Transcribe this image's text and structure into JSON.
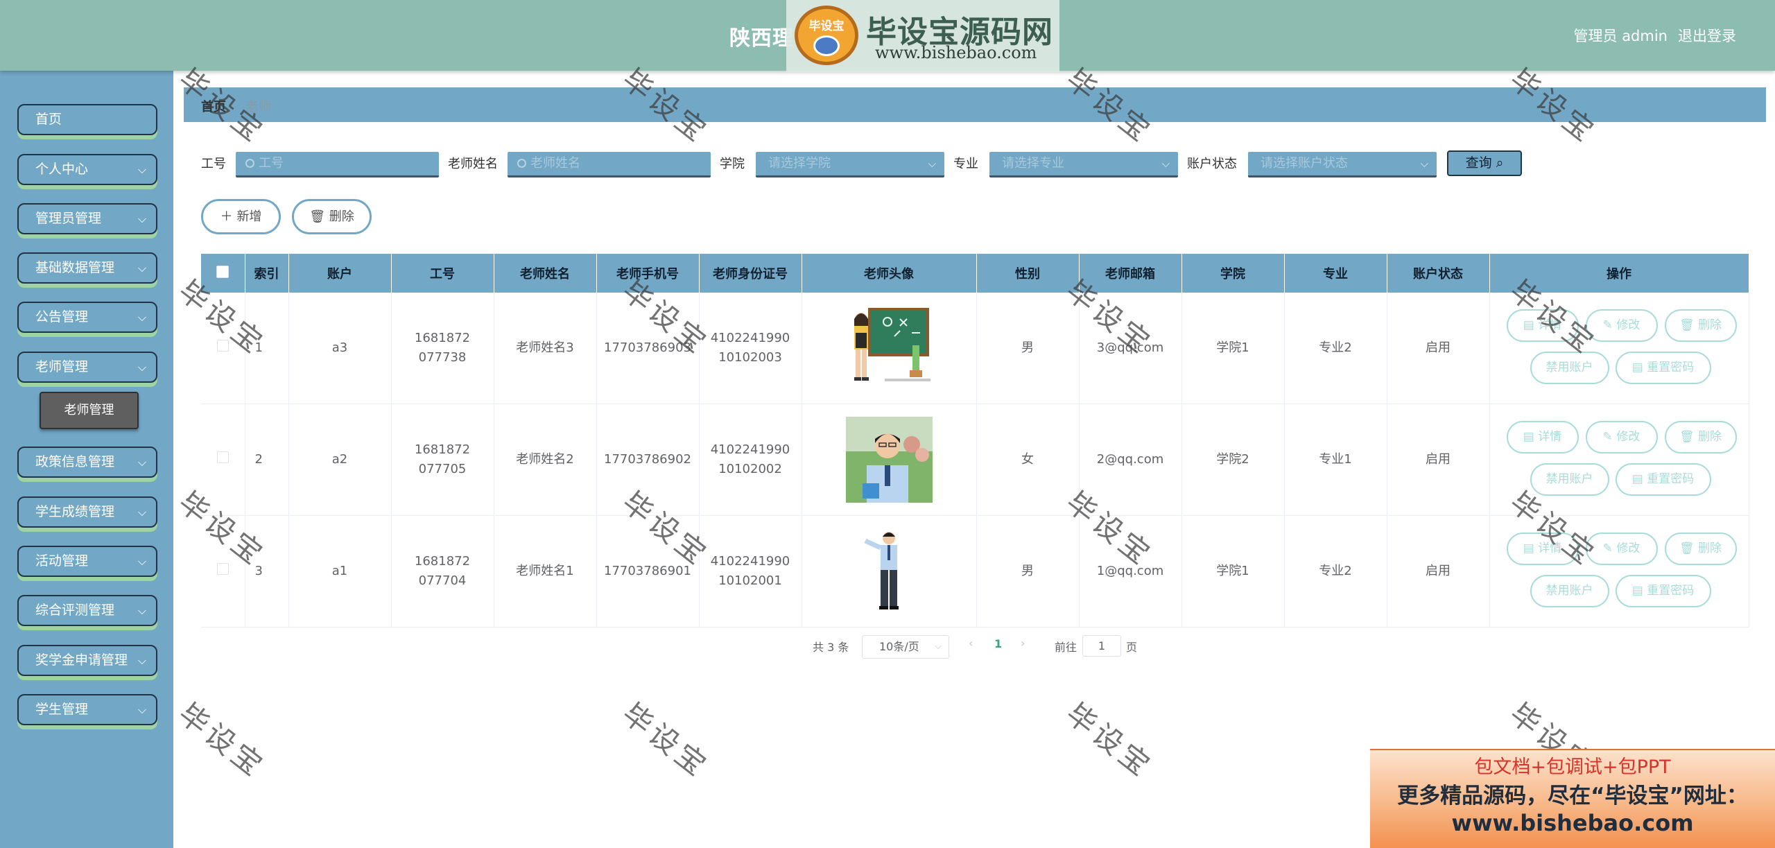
{
  "header": {
    "title": "陕西理",
    "user": "管理员 admin",
    "logout": "退出登录"
  },
  "logo": {
    "badge": "毕设宝",
    "main": "毕设宝源码网",
    "url": "www.bishebao.com"
  },
  "sidebar": {
    "items": [
      {
        "label": "首页"
      },
      {
        "label": "个人中心"
      },
      {
        "label": "管理员管理"
      },
      {
        "label": "基础数据管理"
      },
      {
        "label": "公告管理"
      },
      {
        "label": "老师管理"
      },
      {
        "label": "政策信息管理"
      },
      {
        "label": "学生成绩管理"
      },
      {
        "label": "活动管理"
      },
      {
        "label": "综合评测管理"
      },
      {
        "label": "奖学金申请管理"
      },
      {
        "label": "学生管理"
      }
    ],
    "sub_item": "老师管理"
  },
  "breadcrumb": {
    "home": "首页",
    "sep": "/",
    "current": "老师"
  },
  "search": {
    "gonghao_label": "工号",
    "gonghao_placeholder": "工号",
    "name_label": "老师姓名",
    "name_placeholder": "老师姓名",
    "xueyuan_label": "学院",
    "xueyuan_placeholder": "请选择学院",
    "zhuanye_label": "专业",
    "zhuanye_placeholder": "请选择专业",
    "status_label": "账户状态",
    "status_placeholder": "请选择账户状态",
    "query_button": "查询"
  },
  "actions": {
    "add": "新增",
    "delete": "删除"
  },
  "table": {
    "headers": [
      "索引",
      "账户",
      "工号",
      "老师姓名",
      "老师手机号",
      "老师身份证号",
      "老师头像",
      "性别",
      "老师邮箱",
      "学院",
      "专业",
      "账户状态",
      "操作"
    ],
    "rows": [
      {
        "index": "1",
        "account": "a3",
        "gonghao": "1681872077738",
        "name": "老师姓名3",
        "phone": "17703786903",
        "idcard": "410224199010102003",
        "avatar": "teacher-chalkboard",
        "gender": "男",
        "email": "3@qq.com",
        "xueyuan": "学院1",
        "zhuanye": "专业2",
        "status": "启用"
      },
      {
        "index": "2",
        "account": "a2",
        "gonghao": "1681872077705",
        "name": "老师姓名2",
        "phone": "17703786902",
        "idcard": "410224199010102002",
        "avatar": "teacher-photo",
        "gender": "女",
        "email": "2@qq.com",
        "xueyuan": "学院2",
        "zhuanye": "专业1",
        "status": "启用"
      },
      {
        "index": "3",
        "account": "a1",
        "gonghao": "1681872077704",
        "name": "老师姓名1",
        "phone": "17703786901",
        "idcard": "410224199010102001",
        "avatar": "teacher-standing",
        "gender": "男",
        "email": "1@qq.com",
        "xueyuan": "学院1",
        "zhuanye": "专业2",
        "status": "启用"
      }
    ],
    "ops": {
      "detail": "详情",
      "edit": "修改",
      "delete": "删除",
      "disable": "禁用账户",
      "reset": "重置密码"
    }
  },
  "pagination": {
    "total": "共 3 条",
    "size": "10条/页",
    "page": "1",
    "goto": "前往",
    "input": "1",
    "unit": "页"
  },
  "watermark": "毕设宝",
  "promo": {
    "line1": "包文档+包调试+包PPT",
    "line2": "更多精品源码，尽在“毕设宝”网址：",
    "line3": "www.bishebao.com"
  },
  "colors": {
    "header": "#8dbdb0",
    "sidebar": "#72a8c6",
    "accent_shadow": "#9ed3a6",
    "op_button": "#a8dcd8"
  }
}
